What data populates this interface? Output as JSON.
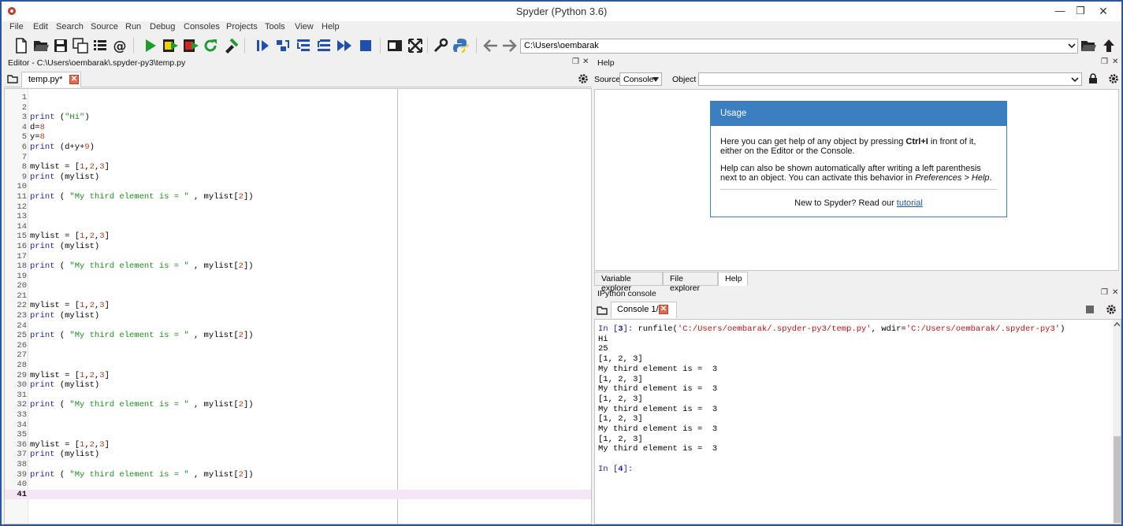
{
  "window": {
    "title": "Spyder (Python 3.6)",
    "min_glyph": "—",
    "max_glyph": "❐",
    "close_glyph": "✕"
  },
  "menu": [
    "File",
    "Edit",
    "Search",
    "Source",
    "Run",
    "Debug",
    "Consoles",
    "Projects",
    "Tools",
    "View",
    "Help"
  ],
  "toolbar": {
    "path": "C:\\Users\\oembarak",
    "icons": [
      "new-file-icon",
      "open-folder-icon",
      "save-icon",
      "save-all-icon",
      "outline-icon",
      "at-icon",
      "run-icon",
      "run-cell-icon",
      "run-cell-advance-icon",
      "rerun-icon",
      "configure-run-icon",
      "debug-icon",
      "step-icon",
      "step-into-icon",
      "step-return-icon",
      "continue-icon",
      "stop-debug-icon",
      "maximize-pane-icon",
      "fullscreen-icon",
      "preferences-icon",
      "python-path-icon",
      "back-icon",
      "forward-icon",
      "browse-icon",
      "parent-dir-icon"
    ]
  },
  "editor": {
    "pane_title": "Editor - C:\\Users\\oembarak\\.spyder-py3\\temp.py",
    "tab_label": "temp.py*",
    "current_line": "41",
    "lines": [
      {
        "n": "1",
        "code": []
      },
      {
        "n": "2",
        "code": []
      },
      {
        "n": "3",
        "code": [
          {
            "t": "print",
            "c": "kw"
          },
          {
            "t": " ("
          },
          {
            "t": "\"Hi\"",
            "c": "st"
          },
          {
            "t": ")"
          }
        ]
      },
      {
        "n": "4",
        "code": [
          {
            "t": "d="
          },
          {
            "t": "8",
            "c": "nm"
          }
        ]
      },
      {
        "n": "5",
        "code": [
          {
            "t": "y="
          },
          {
            "t": "8",
            "c": "nm"
          }
        ]
      },
      {
        "n": "6",
        "code": [
          {
            "t": "print",
            "c": "kw"
          },
          {
            "t": " (d+y+"
          },
          {
            "t": "9",
            "c": "nm"
          },
          {
            "t": ")"
          }
        ]
      },
      {
        "n": "7",
        "code": []
      },
      {
        "n": "8",
        "code": [
          {
            "t": "mylist = ["
          },
          {
            "t": "1",
            "c": "nm"
          },
          {
            "t": ","
          },
          {
            "t": "2",
            "c": "nm"
          },
          {
            "t": ","
          },
          {
            "t": "3",
            "c": "nm"
          },
          {
            "t": "]"
          }
        ]
      },
      {
        "n": "9",
        "code": [
          {
            "t": "print",
            "c": "kw"
          },
          {
            "t": " (mylist)"
          }
        ]
      },
      {
        "n": "10",
        "code": []
      },
      {
        "n": "11",
        "code": [
          {
            "t": "print",
            "c": "kw"
          },
          {
            "t": " ( "
          },
          {
            "t": "\"My third element is = \"",
            "c": "st"
          },
          {
            "t": " , mylist["
          },
          {
            "t": "2",
            "c": "nm"
          },
          {
            "t": "])"
          }
        ]
      },
      {
        "n": "12",
        "code": []
      },
      {
        "n": "13",
        "code": []
      },
      {
        "n": "14",
        "code": []
      },
      {
        "n": "15",
        "code": [
          {
            "t": "mylist = ["
          },
          {
            "t": "1",
            "c": "nm"
          },
          {
            "t": ","
          },
          {
            "t": "2",
            "c": "nm"
          },
          {
            "t": ","
          },
          {
            "t": "3",
            "c": "nm"
          },
          {
            "t": "]"
          }
        ]
      },
      {
        "n": "16",
        "code": [
          {
            "t": "print",
            "c": "kw"
          },
          {
            "t": " (mylist)"
          }
        ]
      },
      {
        "n": "17",
        "code": []
      },
      {
        "n": "18",
        "code": [
          {
            "t": "print",
            "c": "kw"
          },
          {
            "t": " ( "
          },
          {
            "t": "\"My third element is = \"",
            "c": "st"
          },
          {
            "t": " , mylist["
          },
          {
            "t": "2",
            "c": "nm"
          },
          {
            "t": "])"
          }
        ]
      },
      {
        "n": "19",
        "code": []
      },
      {
        "n": "20",
        "code": []
      },
      {
        "n": "21",
        "code": []
      },
      {
        "n": "22",
        "code": [
          {
            "t": "mylist = ["
          },
          {
            "t": "1",
            "c": "nm"
          },
          {
            "t": ","
          },
          {
            "t": "2",
            "c": "nm"
          },
          {
            "t": ","
          },
          {
            "t": "3",
            "c": "nm"
          },
          {
            "t": "]"
          }
        ]
      },
      {
        "n": "23",
        "code": [
          {
            "t": "print",
            "c": "kw"
          },
          {
            "t": " (mylist)"
          }
        ]
      },
      {
        "n": "24",
        "code": []
      },
      {
        "n": "25",
        "code": [
          {
            "t": "print",
            "c": "kw"
          },
          {
            "t": " ( "
          },
          {
            "t": "\"My third element is = \"",
            "c": "st"
          },
          {
            "t": " , mylist["
          },
          {
            "t": "2",
            "c": "nm"
          },
          {
            "t": "])"
          }
        ]
      },
      {
        "n": "26",
        "code": []
      },
      {
        "n": "27",
        "code": []
      },
      {
        "n": "28",
        "code": []
      },
      {
        "n": "29",
        "code": [
          {
            "t": "mylist = ["
          },
          {
            "t": "1",
            "c": "nm"
          },
          {
            "t": ","
          },
          {
            "t": "2",
            "c": "nm"
          },
          {
            "t": ","
          },
          {
            "t": "3",
            "c": "nm"
          },
          {
            "t": "]"
          }
        ]
      },
      {
        "n": "30",
        "code": [
          {
            "t": "print",
            "c": "kw"
          },
          {
            "t": " (mylist)"
          }
        ]
      },
      {
        "n": "31",
        "code": []
      },
      {
        "n": "32",
        "code": [
          {
            "t": "print",
            "c": "kw"
          },
          {
            "t": " ( "
          },
          {
            "t": "\"My third element is = \"",
            "c": "st"
          },
          {
            "t": " , mylist["
          },
          {
            "t": "2",
            "c": "nm"
          },
          {
            "t": "])"
          }
        ]
      },
      {
        "n": "33",
        "code": []
      },
      {
        "n": "34",
        "code": []
      },
      {
        "n": "35",
        "code": []
      },
      {
        "n": "36",
        "code": [
          {
            "t": "mylist = ["
          },
          {
            "t": "1",
            "c": "nm"
          },
          {
            "t": ","
          },
          {
            "t": "2",
            "c": "nm"
          },
          {
            "t": ","
          },
          {
            "t": "3",
            "c": "nm"
          },
          {
            "t": "]"
          }
        ]
      },
      {
        "n": "37",
        "code": [
          {
            "t": "print",
            "c": "kw"
          },
          {
            "t": " (mylist)"
          }
        ]
      },
      {
        "n": "38",
        "code": []
      },
      {
        "n": "39",
        "code": [
          {
            "t": "print",
            "c": "kw"
          },
          {
            "t": " ( "
          },
          {
            "t": "\"My third element is = \"",
            "c": "st"
          },
          {
            "t": " , mylist["
          },
          {
            "t": "2",
            "c": "nm"
          },
          {
            "t": "])"
          }
        ]
      },
      {
        "n": "40",
        "code": []
      },
      {
        "n": "41",
        "code": []
      }
    ]
  },
  "help": {
    "pane_title": "Help",
    "source_label": "Source",
    "source_value": "Console",
    "object_label": "Object",
    "usage_title": "Usage",
    "usage_p1_a": "Here you can get help of any object by pressing ",
    "usage_p1_key": "Ctrl+I",
    "usage_p1_b": " in front of it, either on the Editor or the Console.",
    "usage_p2_a": "Help can also be shown automatically after writing a left parenthesis next to an object. You can activate this behavior in ",
    "usage_p2_pref": "Preferences > Help",
    "usage_p2_b": ".",
    "usage_footer": "New to Spyder? Read our ",
    "usage_link": "tutorial",
    "tabs": [
      "Variable explorer",
      "File explorer",
      "Help"
    ]
  },
  "console": {
    "pane_title": "IPython console",
    "tab_label": "Console 1/A",
    "in3_prompt": "In [",
    "in3_num": "3",
    "in3_close": "]: ",
    "runfile_cmd": "runfile(",
    "runfile_path": "'C:/Users/oembarak/.spyder-py3/temp.py'",
    "runfile_mid": ", wdir=",
    "runfile_wdir": "'C:/Users/oembarak/.spyder-py3'",
    "runfile_end": ")",
    "output": [
      "Hi",
      "25",
      "[1, 2, 3]",
      "My third element is =  3",
      "[1, 2, 3]",
      "My third element is =  3",
      "[1, 2, 3]",
      "My third element is =  3",
      "[1, 2, 3]",
      "My third element is =  3",
      "[1, 2, 3]",
      "My third element is =  3"
    ],
    "in4_prompt": "In [",
    "in4_num": "4",
    "in4_close": "]:"
  },
  "colors": {
    "keyword": "#1f1fb0",
    "string": "#1a8f1a",
    "number": "#c03a16",
    "usage_header": "#3c7fc1",
    "current_line": "#f5e6f5"
  }
}
